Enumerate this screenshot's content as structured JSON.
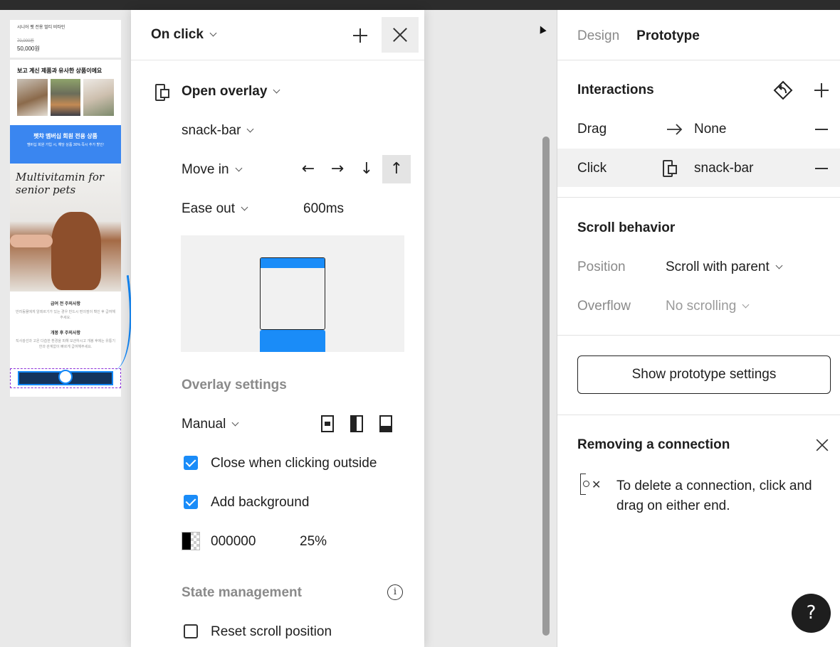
{
  "canvas": {
    "frame": {
      "product_name": "시니어 펫 전용 멀티 비타민",
      "original_price": "70,000원",
      "sale_price": "50,000원",
      "recommend_heading": "보고 계신 제품과 유사한 상품이에요",
      "banner_title": "펫챠 멤버십 회원 전용 상품",
      "banner_sub": "멤버십 회원 가입 시, 해당 상품 30% 즉시 추가 할인!",
      "hero_text": "Multivitamin for senior pets",
      "note1_title": "급여 전 주의사항",
      "note1_body": "반려동물에게 알레르기가 있는 경우 반드시 편의점이 확인 후 급여해주세요.",
      "note2_title": "개봉 후 주의사항",
      "note2_body": "직사광선과 고온 다습한 환경을 피해 보관하시고 개봉 후에는 유통기한과 관계없이 빠르게 급여해주세요."
    }
  },
  "popup": {
    "trigger": "On click",
    "action": "Open overlay",
    "destination": "snack-bar",
    "animation": "Move in",
    "easing": "Ease out",
    "duration": "600ms",
    "directions": [
      "←",
      "→",
      "↓",
      "↑"
    ],
    "overlay_settings_label": "Overlay settings",
    "position_mode": "Manual",
    "close_outside_label": "Close when clicking outside",
    "add_background_label": "Add background",
    "bg_color": "000000",
    "bg_opacity": "25%",
    "state_management_label": "State management",
    "reset_scroll_label": "Reset scroll position",
    "close_when_clicking_outside": true,
    "add_background": true,
    "reset_scroll_position": false,
    "accent_color": "#1a8cf8"
  },
  "panel": {
    "tabs": [
      "Design",
      "Prototype"
    ],
    "active_tab": "Prototype",
    "interactions_heading": "Interactions",
    "interactions": [
      {
        "trigger": "Drag",
        "target": "None"
      },
      {
        "trigger": "Click",
        "target": "snack-bar"
      }
    ],
    "scroll_heading": "Scroll behavior",
    "position_label": "Position",
    "position_value": "Scroll with parent",
    "overflow_label": "Overflow",
    "overflow_value": "No scrolling",
    "proto_settings_button": "Show prototype settings",
    "remove_heading": "Removing a connection",
    "remove_text_line1": "To delete a connection, click and",
    "remove_text_line2": "drag on either end.",
    "help": "?"
  }
}
